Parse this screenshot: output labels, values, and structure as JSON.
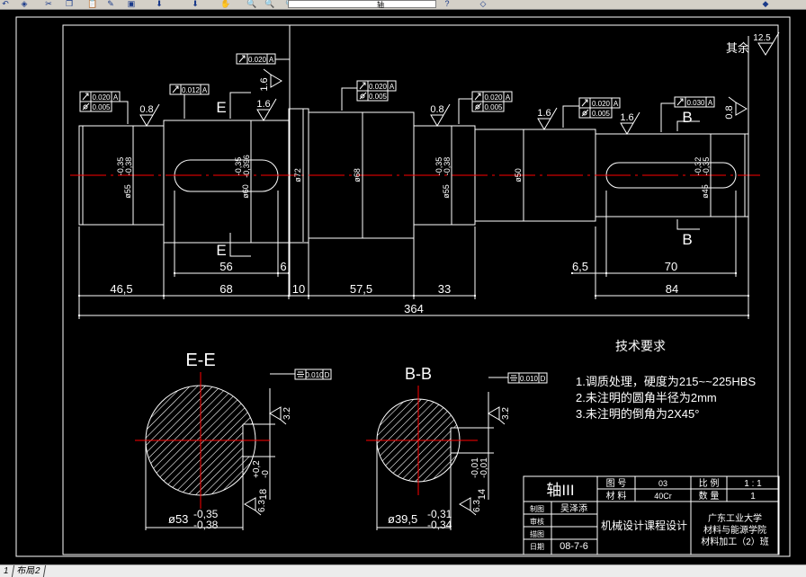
{
  "toolbar": {
    "icons": [
      "undo-icon",
      "match-properties-icon",
      "cut-icon",
      "copy-icon",
      "paste-icon",
      "brush-icon",
      "block-icon",
      "arrow-down-icon",
      "arrow-gray-icon",
      "pan-icon",
      "zoom-realtime-icon",
      "zoom-window-icon",
      "zoom-previous-icon",
      "properties-icon",
      "design-center-icon",
      "tool-palette-icon",
      "sheet-set-icon",
      "markup-icon",
      "calculator-icon",
      "help-icon",
      "layers-icon",
      "layer-state-icon"
    ],
    "layer_value": "轴"
  },
  "tabs": [
    "1",
    "布局2"
  ],
  "colors": {
    "background": "#000000",
    "lines": "#ffffff",
    "centerline": "#ff0000"
  },
  "main_view": {
    "other_finish_label": "其余",
    "other_finish_value": "12.5",
    "section_marks": [
      "E",
      "E",
      "B",
      "B"
    ],
    "dims": [
      "46,5",
      "68",
      "10",
      "57,5",
      "33",
      "84",
      "364",
      "56",
      "6",
      "6,5",
      "70"
    ],
    "diameters": [
      {
        "d": "ø55",
        "upper": "-0,35",
        "lower": "-0,38"
      },
      {
        "d": "ø60",
        "upper": "-0,35",
        "lower": "-0,396"
      },
      {
        "d": "ø72",
        "upper": "",
        "lower": ""
      },
      {
        "d": "ø68",
        "upper": "",
        "lower": ""
      },
      {
        "d": "ø55",
        "upper": "-0,35",
        "lower": "-0,38"
      },
      {
        "d": "ø50",
        "upper": "",
        "lower": ""
      },
      {
        "d": "ø45",
        "upper": "-0,32",
        "lower": "-0,35"
      }
    ],
    "roughness": [
      "0.8",
      "1.6",
      "1.6",
      "0.8",
      "1.6",
      "1.6",
      "0.8"
    ],
    "tolerances": [
      {
        "rows": [
          {
            "symbol": "runout",
            "value": "0.020",
            "datum": "A"
          },
          {
            "symbol": "cylindricity",
            "value": "0.005",
            "datum": ""
          }
        ]
      },
      {
        "rows": [
          {
            "symbol": "runout",
            "value": "0.012",
            "datum": "A"
          }
        ]
      },
      {
        "rows": [
          {
            "symbol": "runout",
            "value": "0.020",
            "datum": "A"
          }
        ]
      },
      {
        "rows": [
          {
            "symbol": "runout",
            "value": "0.020",
            "datum": "A"
          },
          {
            "symbol": "cylindricity",
            "value": "0.005",
            "datum": ""
          }
        ]
      },
      {
        "rows": [
          {
            "symbol": "runout",
            "value": "0.020",
            "datum": "A"
          },
          {
            "symbol": "cylindricity",
            "value": "0.005",
            "datum": ""
          }
        ]
      },
      {
        "rows": [
          {
            "symbol": "runout",
            "value": "0.020",
            "datum": "A"
          },
          {
            "symbol": "cylindricity",
            "value": "0.005",
            "datum": ""
          }
        ]
      },
      {
        "rows": [
          {
            "symbol": "runout",
            "value": "0.030",
            "datum": "A"
          }
        ]
      }
    ]
  },
  "sections": [
    {
      "title": "E-E",
      "diameter": "ø53",
      "upper": "-0,35",
      "lower": "-0,38",
      "key": "18",
      "key_upper": "+0,2",
      "key_lower": "-0",
      "rough_a": "3.2",
      "rough_b": "6.3",
      "tol_value": "0.010",
      "tol_datum": "D"
    },
    {
      "title": "B-B",
      "diameter": "ø39,5",
      "upper": "-0,31",
      "lower": "-0,34",
      "key": "14",
      "key_upper": "-0,01",
      "key_lower": "-0,01",
      "rough_a": "3.2",
      "rough_b": "6.3",
      "tol_value": "0.010",
      "tol_datum": "D"
    }
  ],
  "tech_requirements": {
    "title": "技术要求",
    "items": [
      "1.调质处理，硬度为215~~225HBS",
      "2.未注明的圆角半径为2mm",
      "3.未注明的倒角为2X45°"
    ]
  },
  "title_block": {
    "part_name": "轴III",
    "drawing_no_label": "图 号",
    "drawing_no": "03",
    "scale_label": "比 例",
    "scale": "1 : 1",
    "material_label": "材 料",
    "material": "40Cr",
    "quantity_label": "数 量",
    "quantity": "1",
    "roles": [
      "制图",
      "审核",
      "描图",
      "日期"
    ],
    "designer": "吴泽添",
    "date": "08-7-6",
    "course": "机械设计课程设计",
    "school": [
      "广东工业大学",
      "材料与能源学院",
      "材料加工（2）班"
    ]
  }
}
